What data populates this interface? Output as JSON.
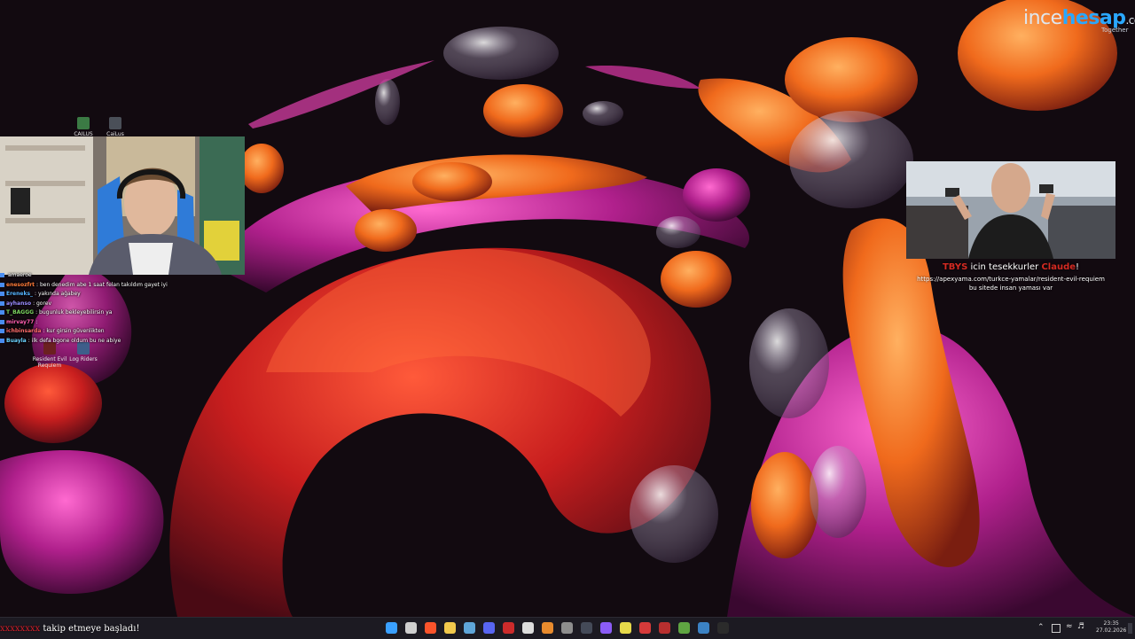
{
  "branding": {
    "name_part1": "ince",
    "name_part2": "hesap",
    "suffix": ".com",
    "sub": "Together"
  },
  "desktop_icons": [
    {
      "label": "CAILUS",
      "color": "#3b7a44"
    },
    {
      "label": "CaiLus",
      "color": "#4a4f58"
    },
    {
      "label": "Resident Evil Requiem",
      "color": "#6b2020"
    },
    {
      "label": "Log Riders",
      "color": "#3e5e8a"
    }
  ],
  "chat": {
    "messages": [
      {
        "user": "",
        "text": "amaeroe",
        "color": "#e8a33b"
      },
      {
        "user": "enesozfrt",
        "text": ": ben denedim abe 1 saat felan takıldım gayet iyi",
        "color": "#ff7b39"
      },
      {
        "user": "Ereneks_",
        "text": ": yakında ağabey",
        "color": "#56b4ff"
      },
      {
        "user": "ayhanso",
        "text": ": gorev",
        "color": "#9b8cff"
      },
      {
        "user": "T_BAGGG",
        "text": ": bugunluk bekleyebilirsin ya",
        "color": "#7bd35f"
      },
      {
        "user": "mirvay77",
        "text": ": ",
        "color": "#ff5fb1"
      },
      {
        "user": "ichbinsarda",
        "text": ": kur girsin güvenlikten",
        "color": "#ff6b6b"
      },
      {
        "user": "Buayla",
        "text": ": ilk defa bgone oldum bu ne abiye",
        "color": "#6bd3ff"
      }
    ]
  },
  "donation": {
    "donor": "TBYS",
    "thanks_text": "icin tesekkurler",
    "streamer": "Claude",
    "exclaim": "!",
    "message": "https://apexyama.com/turkce-yamalar/resident-evil-requiem bu sitede insan yaması var"
  },
  "follow_alert": {
    "user": "xxxxxxxx",
    "text": "takip etmeye başladı!"
  },
  "taskbar": {
    "apps": [
      {
        "name": "windows-start-icon",
        "color": "#3aa0ff"
      },
      {
        "name": "search-icon",
        "color": "#cfcfcf"
      },
      {
        "name": "brave-browser-icon",
        "color": "#fb542b"
      },
      {
        "name": "file-explorer-icon",
        "color": "#f2c94c"
      },
      {
        "name": "steam-icon",
        "color": "#5fa6d9"
      },
      {
        "name": "discord-icon",
        "color": "#5865f2"
      },
      {
        "name": "app-red-icon",
        "color": "#cc2b2b"
      },
      {
        "name": "epic-games-icon",
        "color": "#dddddd"
      },
      {
        "name": "app-orange-icon",
        "color": "#e88b2e"
      },
      {
        "name": "app-gray-icon",
        "color": "#8e8e8e"
      },
      {
        "name": "obs-icon",
        "color": "#444a58"
      },
      {
        "name": "app-purple-icon",
        "color": "#8b5cf6"
      },
      {
        "name": "app-yellow-icon",
        "color": "#e6d94a"
      },
      {
        "name": "app-red2-icon",
        "color": "#d63a3a"
      },
      {
        "name": "app-red3-icon",
        "color": "#b82f2f"
      },
      {
        "name": "minecraft-icon",
        "color": "#5fa542"
      },
      {
        "name": "app-blue-icon",
        "color": "#3b82c4"
      },
      {
        "name": "app-dark-icon",
        "color": "#2b2b2b"
      }
    ],
    "clock_time": "23:35",
    "clock_date": "27.02.2026"
  }
}
